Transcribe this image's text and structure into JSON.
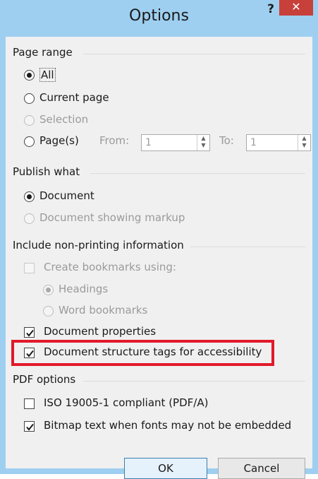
{
  "window": {
    "title": "Options",
    "help_label": "?",
    "close_label": "✕"
  },
  "page_range": {
    "heading": "Page range",
    "all": "All",
    "current_page": "Current page",
    "selection": "Selection",
    "pages": "Page(s)",
    "from_label": "From:",
    "from_value": "1",
    "to_label": "To:",
    "to_value": "1",
    "selected": "all"
  },
  "publish_what": {
    "heading": "Publish what",
    "document": "Document",
    "document_markup": "Document showing markup",
    "selected": "document"
  },
  "non_printing": {
    "heading": "Include non-printing information",
    "create_bookmarks": "Create bookmarks using:",
    "headings": "Headings",
    "word_bookmarks": "Word bookmarks",
    "document_properties": "Document properties",
    "structure_tags": "Document structure tags for accessibility",
    "create_bookmarks_checked": false,
    "document_properties_checked": true,
    "structure_tags_checked": true
  },
  "pdf_options": {
    "heading": "PDF options",
    "iso": "ISO 19005-1 compliant (PDF/A)",
    "bitmap_text": "Bitmap text when fonts may not be embedded",
    "iso_checked": false,
    "bitmap_text_checked": true
  },
  "buttons": {
    "ok": "OK",
    "cancel": "Cancel"
  },
  "colors": {
    "titlebar": "#9ecff0",
    "close": "#c7403a",
    "highlight": "#e1192a"
  }
}
